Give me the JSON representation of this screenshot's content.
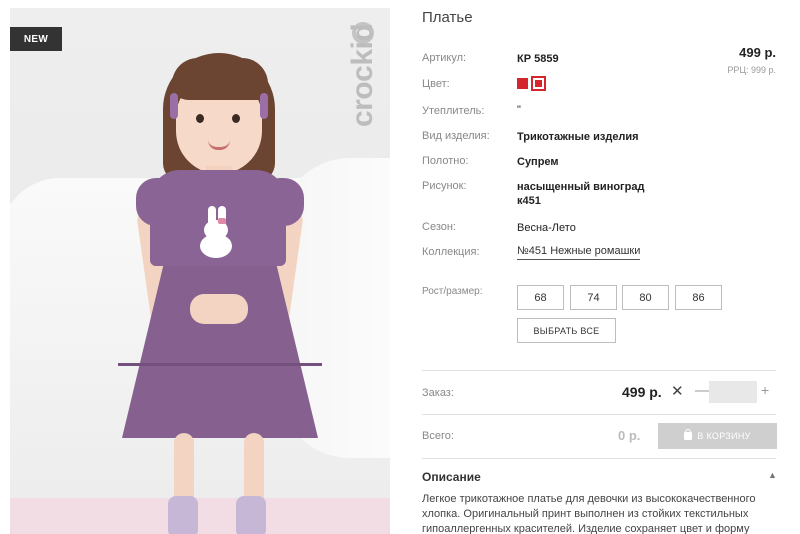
{
  "photo": {
    "badge": "NEW",
    "brand": "crockid",
    "brand_icon": "crockid-logo-icon"
  },
  "product": {
    "title": "Платье",
    "price": "499 р.",
    "rrp": "РРЦ: 999 р.",
    "attributes": [
      {
        "label": "Артикул:",
        "value": "КР 5859"
      },
      {
        "label": "Цвет:",
        "value": ""
      },
      {
        "label": "Утеплитель:",
        "value": "\""
      },
      {
        "label": "Вид изделия:",
        "value": "Трикотажные изделия"
      },
      {
        "label": "Полотно:",
        "value": "Супрем"
      },
      {
        "label": "Рисунок:",
        "value": "насыщенный виноград\nк451"
      },
      {
        "label": "Сезон:",
        "value": "Весна-Лето"
      },
      {
        "label": "Коллекция:",
        "value": "№451 Нежные ромашки"
      }
    ],
    "colors": [
      "#d3262d",
      "#d3262d"
    ],
    "size_label": "Рост/размер:",
    "sizes": [
      "68",
      "74",
      "80",
      "86"
    ],
    "select_all": "ВЫБРАТЬ ВСЕ"
  },
  "order": {
    "label": "Заказ:",
    "price": "499 р.",
    "times": "✕",
    "minus": "—",
    "qty": "",
    "plus": "+"
  },
  "total": {
    "label": "Всего:",
    "value": "0 р.",
    "cart_button": "В КОРЗИНУ"
  },
  "description": {
    "title": "Описание",
    "toggle": "▲",
    "text": "Легкое трикотажное платье для девочки из высококачественного хлопка. Оригинальный принт выполнен из стойких текстильных гипоаллергенных красителей. Изделие сохраняет цвет и форму"
  }
}
